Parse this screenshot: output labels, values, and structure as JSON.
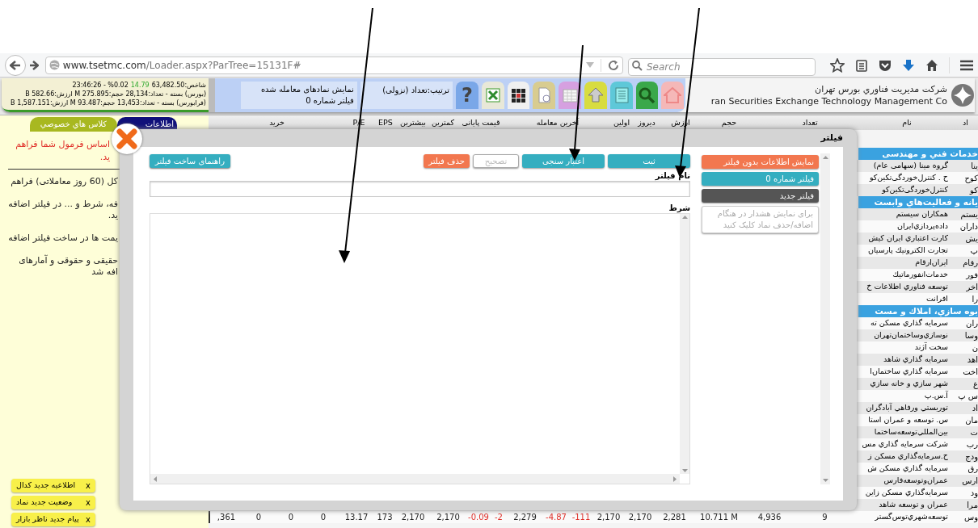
{
  "browser": {
    "url_host": "www.tsetmc.com",
    "url_path": "/Loader.aspx?ParTree=15131F#",
    "search_placeholder": "Search"
  },
  "header": {
    "index_line": {
      "time": "23:46:26 - %0.02",
      "change": "14.79",
      "value": "63,482.50:شاخص"
    },
    "market_lines": [
      "(بورس) بسته - تعداد:28,134 حجم:275.895 M ارزش:582.66 B",
      "(فرابورس) بسته - تعداد:13,453 حجم:93.487 M ارزش:1,587.151 B"
    ],
    "filter_info": {
      "line1": "نمایش نمادهای معامله شده",
      "line2": "فیلتر شماره 0"
    },
    "sort": "ترتیب:تعداد (نزولی)",
    "tools": [
      {
        "kind": "help",
        "text": "?"
      },
      {
        "kind": "excel"
      },
      {
        "kind": "grid"
      },
      {
        "kind": "document"
      },
      {
        "kind": "calendar"
      },
      {
        "kind": "up"
      },
      {
        "kind": "list"
      },
      {
        "kind": "search"
      },
      {
        "kind": "home"
      }
    ],
    "company_fa": "شرکت مدیریت فناوري بورس تهران",
    "company_en": "ran Securities Exchange Technology Management Co"
  },
  "side_panel": {
    "tabs": [
      {
        "label": "اطلاعات",
        "color": "#10107a"
      },
      {
        "label": "کلاس هاي خصوصي",
        "color": "#a8b820"
      }
    ],
    "alert_lines": [
      "اساس فرمول شما فراهم",
      "ید."
    ],
    "notes": [
      "کل (60 روز معاملاتی) فراهم",
      "فه، شرط و ... در فیلتر اضافه\nید.",
      "یمت ها در ساخت فیلتر اضافه",
      "حقیقی و حقوقی و آمارهای\nافه شد"
    ],
    "notifications": [
      {
        "close": "x",
        "label": "اطلاعیه جدید کدال"
      },
      {
        "close": "x",
        "label": "وضعیت جدید نماد"
      },
      {
        "close": "x",
        "label": "پیام جدید ناظر بازار"
      }
    ]
  },
  "table": {
    "columns": [
      "اد",
      "نام",
      "تعداد",
      "حجم",
      "ارزش",
      "دیروز",
      "اولین",
      "آخرین معامله",
      "قیمت پایانی",
      "کمترین",
      "بیشترین",
      "EPS",
      "P/E",
      "خرید"
    ],
    "rows": [
      {
        "kind": "section",
        "label": "خدمات فني و مهندسی"
      },
      {
        "kind": "stock",
        "symbol": "ینا",
        "name": "گروه مینا (سهامی عام)"
      },
      {
        "kind": "stock",
        "symbol": "کوح",
        "name": "ح . کنترل‌خوردگی‌تکین‌کو"
      },
      {
        "kind": "stock",
        "symbol": "کو",
        "name": "کنترل‌خوردگی‌تکین‌کو"
      },
      {
        "kind": "section",
        "label": "یانه و فعالیت‌هاي وابست"
      },
      {
        "kind": "stock",
        "symbol": "یستم",
        "name": "همکاران سیستم"
      },
      {
        "kind": "stock",
        "symbol": "داران",
        "name": "داده‌پردازي‌ایران"
      },
      {
        "kind": "stock",
        "symbol": "یش",
        "name": "کارت اعتباري ایران کیش"
      },
      {
        "kind": "stock",
        "symbol": "پ",
        "name": "تجارت الکترونیك پارسیان"
      },
      {
        "kind": "stock",
        "symbol": "رقام",
        "name": "ایران‌ارقام"
      },
      {
        "kind": "stock",
        "symbol": "فور",
        "name": "خدمات‌انفورماتیك"
      },
      {
        "kind": "stock",
        "symbol": "اخر",
        "name": "توسعه فناوري اطلاعات خ"
      },
      {
        "kind": "stock",
        "symbol": "را",
        "name": "افرانت"
      },
      {
        "kind": "section",
        "label": "بوه سازي، املاك و مست"
      },
      {
        "kind": "stock",
        "symbol": "ران",
        "name": "سرمایه گذاري مسکن ته"
      },
      {
        "kind": "stock",
        "symbol": "وسا",
        "name": "نوسازي‌وساختمان‌تهران"
      },
      {
        "kind": "stock",
        "symbol": "ن",
        "name": "سخت آژند"
      },
      {
        "kind": "stock",
        "symbol": "اهد",
        "name": "سرمایه گذاري شاهد"
      },
      {
        "kind": "stock",
        "symbol": "اخت",
        "name": "سرمایه گذاري ساختمان‌ا"
      },
      {
        "kind": "stock",
        "symbol": "غ",
        "name": "شهر سازي و خانه سازي"
      },
      {
        "kind": "stock",
        "symbol": "س پ",
        "name": "آ.س.پ"
      },
      {
        "kind": "stock",
        "symbol": "اد",
        "name": "توریستي ورفاهي آبادگران"
      },
      {
        "kind": "stock",
        "symbol": "مان",
        "name": "س. توسعه و عمران استا"
      },
      {
        "kind": "stock",
        "symbol": "ت",
        "name": "بین‌المللي‌توسعه‌ساختما"
      },
      {
        "kind": "stock",
        "symbol": "رب",
        "name": "شرکت سرمایه گذاري مس"
      },
      {
        "kind": "stock",
        "symbol": "ودج",
        "name": "ح.سرمایه‌گذاري مسکن ز"
      },
      {
        "kind": "stock",
        "symbol": "رق",
        "name": "سرمایه گذاري مسکن ش"
      },
      {
        "kind": "stock",
        "symbol": "ارس",
        "name": "عمران‌وتوسعه‌فارس"
      },
      {
        "kind": "stock",
        "symbol": "ود",
        "name": "سرمایه‌گذاري مسکن زاین"
      },
      {
        "kind": "stock",
        "symbol": "مرا",
        "name": "عمران و توسعه شاهد"
      },
      {
        "kind": "stock",
        "symbol": "وس",
        "name": "توسعه‌شهري‌توس‌گستر",
        "cells": [
          {
            "text": "9",
            "negative": false
          },
          {
            "text": "4,936",
            "negative": false
          },
          {
            "text": "10.711 M",
            "negative": false
          },
          {
            "text": "2,281",
            "negative": false
          },
          {
            "text": "2,170",
            "negative": false
          },
          {
            "text": "2,170",
            "negative": false
          },
          {
            "text": "-111",
            "negative": true
          },
          {
            "text": "-4.87",
            "negative": true
          },
          {
            "text": "2,279",
            "negative": false
          },
          {
            "text": "-2",
            "negative": true
          },
          {
            "text": "-0.09",
            "negative": true
          },
          {
            "text": "2,170",
            "negative": false
          },
          {
            "text": "2,170",
            "negative": false
          },
          {
            "text": "173",
            "negative": false
          },
          {
            "text": "13.17",
            "negative": false
          },
          {
            "text": "0",
            "negative": false
          },
          {
            "text": "0",
            "negative": false
          },
          {
            "text": "0",
            "negative": false
          },
          {
            "text": ",361",
            "negative": false
          }
        ]
      }
    ]
  },
  "modal": {
    "title": "فیلتر",
    "filters": [
      {
        "kind": "unfiltered",
        "label": "نمایش اطلاعات بدون فیلتر"
      },
      {
        "kind": "filter",
        "label": "فیلتر شماره 0"
      },
      {
        "kind": "new",
        "label": "فیلتر جدید"
      },
      {
        "kind": "hint",
        "label": "برای نمایش هشدار در هنگام اضافه/حذف نماد کلیک کنید"
      }
    ],
    "actions": [
      {
        "kind": "primary",
        "label": "ثبت",
        "disabled": false
      },
      {
        "kind": "primary",
        "label": "اعتبار سنجی",
        "disabled": false
      },
      {
        "kind": "plain",
        "label": "تصحیح",
        "disabled": true
      },
      {
        "kind": "danger",
        "label": "حذف فیلتر",
        "disabled": false
      }
    ],
    "help_button": "راهنمای ساخت فیلتر",
    "name_label": "نام فیلتر",
    "condition_label": "شرط"
  }
}
